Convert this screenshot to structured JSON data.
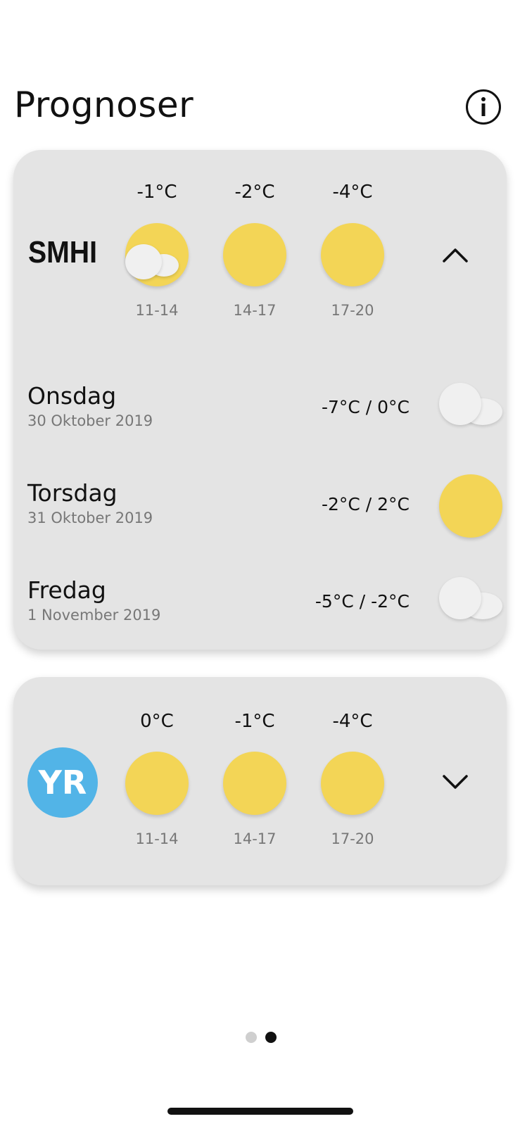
{
  "header": {
    "title": "Prognoser",
    "info_icon": "info-icon"
  },
  "smhi": {
    "provider_logo_text": "SMHI",
    "expanded": true,
    "hours": [
      {
        "temp": "-1°C",
        "time": "11-14",
        "icon": "partly-cloudy-icon"
      },
      {
        "temp": "-2°C",
        "time": "14-17",
        "icon": "sun-icon"
      },
      {
        "temp": "-4°C",
        "time": "17-20",
        "icon": "sun-icon"
      }
    ],
    "days": [
      {
        "name": "Onsdag",
        "date": "30 Oktober 2019",
        "temp": "-7°C / 0°C",
        "icon": "cloud-icon"
      },
      {
        "name": "Torsdag",
        "date": "31 Oktober 2019",
        "temp": "-2°C / 2°C",
        "icon": "sun-icon"
      },
      {
        "name": "Fredag",
        "date": "1 November 2019",
        "temp": "-5°C / -2°C",
        "icon": "cloud-icon"
      }
    ],
    "toggle_icon": "chevron-up-icon"
  },
  "yr": {
    "provider_logo_text": "YR",
    "expanded": false,
    "hours": [
      {
        "temp": "0°C",
        "time": "11-14",
        "icon": "sun-icon"
      },
      {
        "temp": "-1°C",
        "time": "14-17",
        "icon": "sun-icon"
      },
      {
        "temp": "-4°C",
        "time": "17-20",
        "icon": "sun-icon"
      }
    ],
    "toggle_icon": "chevron-down-icon"
  },
  "pager": {
    "count": 2,
    "active_index": 1
  },
  "colors": {
    "sun": "#f3d556",
    "cloud": "#f0f0f0",
    "card_bg": "#e4e4e4",
    "yr_brand": "#52b4e7",
    "dot_inactive": "#cfcfcf",
    "dot_active": "#111111"
  }
}
